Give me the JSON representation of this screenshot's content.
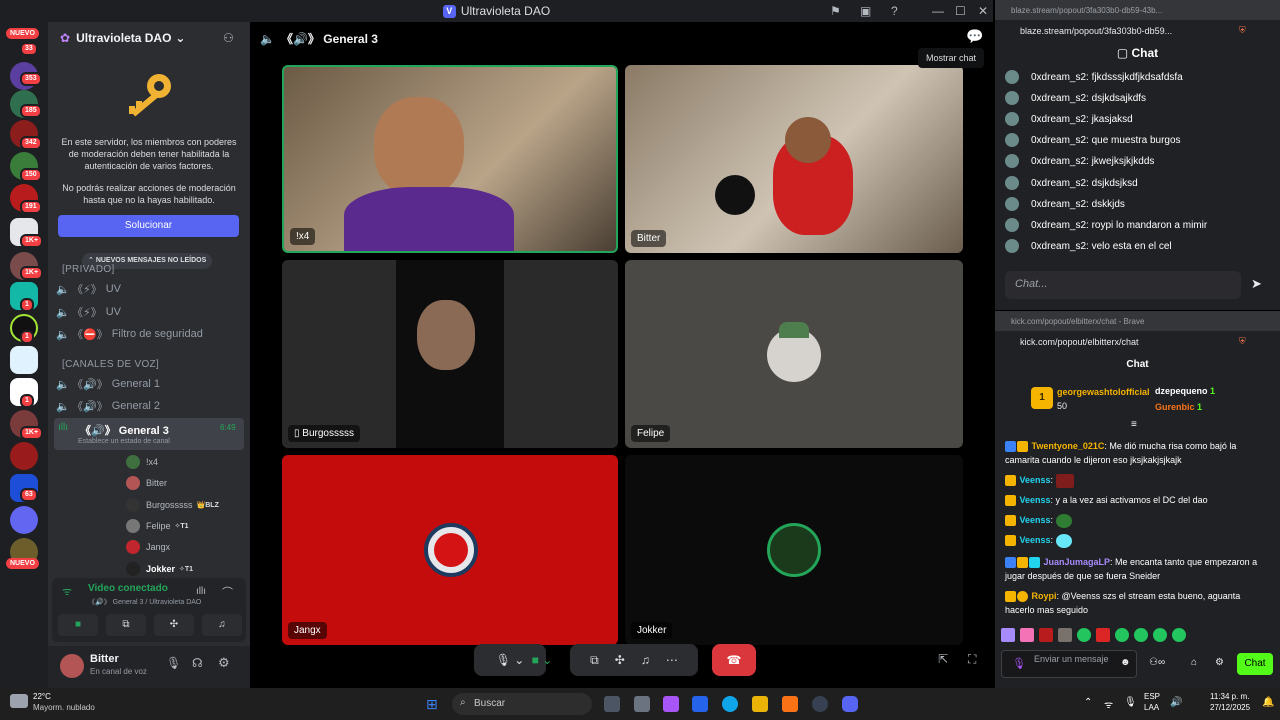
{
  "window": {
    "title": "Ultravioleta DAO",
    "logo_letter": "V"
  },
  "rail": {
    "new_top": "NUEVO",
    "new_bottom": "NUEVO",
    "badges": [
      "33",
      "353",
      "185",
      "342",
      "150",
      "191",
      "1K+",
      "1K+",
      "1",
      "1",
      "1",
      "1K+",
      "1",
      "63",
      "1"
    ]
  },
  "server": {
    "name": "Ultravioleta DAO",
    "mfa_notice": "En este servidor, los miembros con poderes de moderación deben tener habilitada la autenticación de varios factores.",
    "mfa_notice2": "No podrás realizar acciones de moderación hasta que no la hayas habilitado.",
    "fix_button": "Solucionar",
    "new_messages_pill": "NUEVOS MENSAJES NO LEÍDOS",
    "category_private": "[PRIVADO]",
    "category_voice": "[CANALES DE VOZ]",
    "private_channels": [
      "UV",
      "UV",
      "Filtro de seguridad"
    ],
    "private_prefix": "《⚡》",
    "private_prefix_shield": "《⛔》",
    "voice_prefix": "《🔊》",
    "voice_channels": [
      "General 1",
      "General 2",
      "General 3"
    ],
    "active_timer": "6:49",
    "status_hint": "Establece un estado de canal",
    "voice_users": [
      {
        "name": "!x4",
        "tag": ""
      },
      {
        "name": "Bitter",
        "tag": ""
      },
      {
        "name": "Burgosssss",
        "tag": "👑BLZ"
      },
      {
        "name": "Felipe",
        "tag": "✧T1"
      },
      {
        "name": "Jangx",
        "tag": ""
      },
      {
        "name": "Jokker",
        "tag": "✧T1"
      }
    ]
  },
  "voice_panel": {
    "status": "Video conectado",
    "channel_path": "《🔊》 General 3 / Ultravioleta DAO",
    "user": "Bitter",
    "user_status": "En canal de voz"
  },
  "stage": {
    "header": "《🔊》 General 3",
    "tooltip": "Mostrar chat",
    "tiles": [
      {
        "label": "!x4"
      },
      {
        "label": "Bitter"
      },
      {
        "label": "Burgosssss"
      },
      {
        "label": "Felipe"
      },
      {
        "label": "Jangx"
      },
      {
        "label": "Jokker"
      }
    ]
  },
  "blaze": {
    "tab_url": "blaze.stream/popout/3fa303b0-db59-43b...",
    "url": "blaze.stream/popout/3fa303b0-db59...",
    "header": "Chat",
    "messages": [
      "0xdream_s2: fjkdsssjkdfjkdsafdsfa",
      "0xdream_s2: dsjkdsajkdfs",
      "0xdream_s2: jkasjaksd",
      "0xdream_s2: que muestra burgos",
      "0xdream_s2: jkwejksjkjkdds",
      "0xdream_s2: dsjkdsjksd",
      "0xdream_s2: dskkjds",
      "0xdream_s2: roypi lo mandaron a mimir",
      "0xdream_s2: velo esta en el cel"
    ],
    "input_placeholder": "Chat..."
  },
  "kick": {
    "tab_title": "kick.com/popout/elbitterx/chat - Brave",
    "url": "kick.com/popout/elbitterx/chat",
    "header": "Chat",
    "top_gifter": {
      "rank": "1",
      "name": "georgewashtolofficial",
      "amount": "50"
    },
    "gifter2": {
      "name": "dzepequeno",
      "amount": "1"
    },
    "gifter3": {
      "name": "Gurenbic",
      "amount": "1"
    },
    "messages": [
      {
        "user": "Twentyone_021C",
        "color": "#f5b400",
        "text": ": Me dió mucha risa como bajó la camarita cuando le dijeron eso jksjkakjsjkajk"
      },
      {
        "user": "Veenss",
        "color": "#22d3ee",
        "text": ":"
      },
      {
        "user": "Veenss",
        "color": "#22d3ee",
        "text": ": y a la vez asi activamos el DC del dao"
      },
      {
        "user": "Veenss",
        "color": "#22d3ee",
        "text": ":"
      },
      {
        "user": "Veenss",
        "color": "#22d3ee",
        "text": ":"
      },
      {
        "user": "JuanJumagaLP",
        "color": "#a78bfa",
        "text": ": Me encanta tanto que empezaron a jugar después de que se fuera Sneider"
      },
      {
        "user": "Roypi",
        "color": "#f5b400",
        "text": ": @Veenss szs el stream esta bueno, aguanta hacerlo mas seguido"
      }
    ],
    "input_placeholder": "Enviar un mensaje",
    "chat_button": "Chat"
  },
  "taskbar": {
    "weather_temp": "22°C",
    "weather_desc": "Mayorm. nublado",
    "search": "Buscar",
    "lang": "ESP",
    "lang2": "LAA",
    "time": "11:34 p. m.",
    "date": "27/12/2025"
  }
}
